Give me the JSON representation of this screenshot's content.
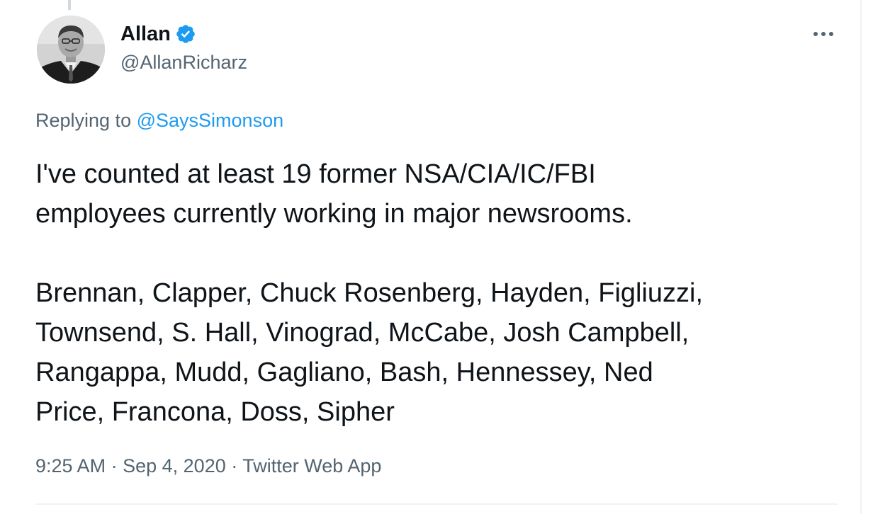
{
  "author": {
    "display_name": "Allan",
    "handle": "@AllanRicharz",
    "avatar_icon": "profile-photo",
    "verified_icon": "verified-badge-icon",
    "verified_color": "#1d9bf0"
  },
  "reply": {
    "prefix": "Replying to",
    "mention": "@SaysSimonson"
  },
  "tweet": {
    "lines": [
      "I've counted at least 19 former NSA/CIA/IC/FBI",
      "employees currently working in major newsrooms.",
      "Brennan, Clapper, Chuck Rosenberg, Hayden, Figliuzzi,",
      "Townsend, S. Hall, Vinograd, McCabe, Josh Campbell,",
      "Rangappa, Mudd, Gagliano, Bash, Hennessey, Ned",
      "Price, Francona, Doss, Sipher"
    ]
  },
  "meta": {
    "time": "9:25 AM",
    "separator": "·",
    "date": "Sep 4, 2020",
    "source": "Twitter Web App"
  },
  "more_icon": "more-options-icon",
  "colors": {
    "text": "#0f1419",
    "secondary": "#536471",
    "link": "#1d9bf0",
    "divider": "#eff3f4"
  }
}
